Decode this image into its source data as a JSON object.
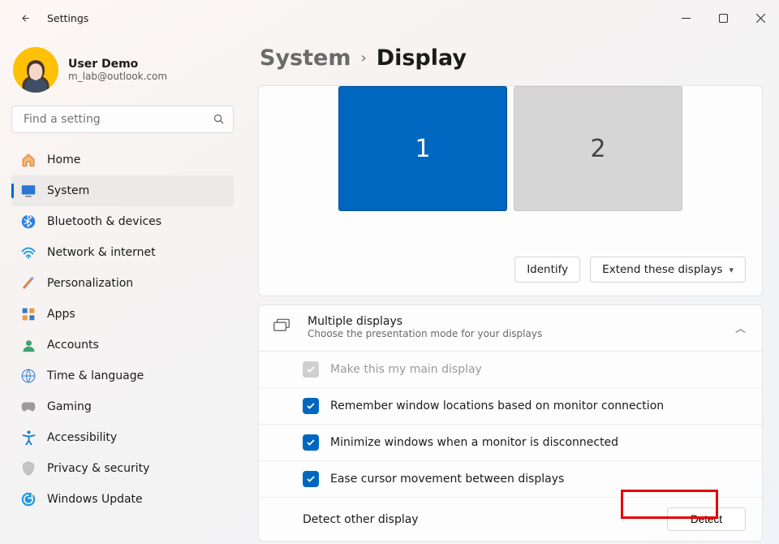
{
  "window": {
    "title": "Settings"
  },
  "user": {
    "name": "User Demo",
    "email": "m_lab@outlook.com"
  },
  "search": {
    "placeholder": "Find a setting"
  },
  "nav": {
    "items": [
      {
        "label": "Home"
      },
      {
        "label": "System"
      },
      {
        "label": "Bluetooth & devices"
      },
      {
        "label": "Network & internet"
      },
      {
        "label": "Personalization"
      },
      {
        "label": "Apps"
      },
      {
        "label": "Accounts"
      },
      {
        "label": "Time & language"
      },
      {
        "label": "Gaming"
      },
      {
        "label": "Accessibility"
      },
      {
        "label": "Privacy & security"
      },
      {
        "label": "Windows Update"
      }
    ],
    "selected_index": 1
  },
  "breadcrumb": {
    "parent": "System",
    "separator": "›",
    "current": "Display"
  },
  "monitors": [
    {
      "id": "1",
      "selected": true
    },
    {
      "id": "2",
      "selected": false
    }
  ],
  "actions": {
    "identify": "Identify",
    "mode_dropdown": "Extend these displays"
  },
  "multiple_displays": {
    "title": "Multiple displays",
    "subtitle": "Choose the presentation mode for your displays",
    "options": {
      "main": {
        "label": "Make this my main display",
        "checked": true,
        "enabled": false
      },
      "remember": {
        "label": "Remember window locations based on monitor connection",
        "checked": true,
        "enabled": true
      },
      "minimize": {
        "label": "Minimize windows when a monitor is disconnected",
        "checked": true,
        "enabled": true
      },
      "ease": {
        "label": "Ease cursor movement between displays",
        "checked": true,
        "enabled": true
      }
    },
    "detect": {
      "label": "Detect other display",
      "button": "Detect"
    }
  }
}
